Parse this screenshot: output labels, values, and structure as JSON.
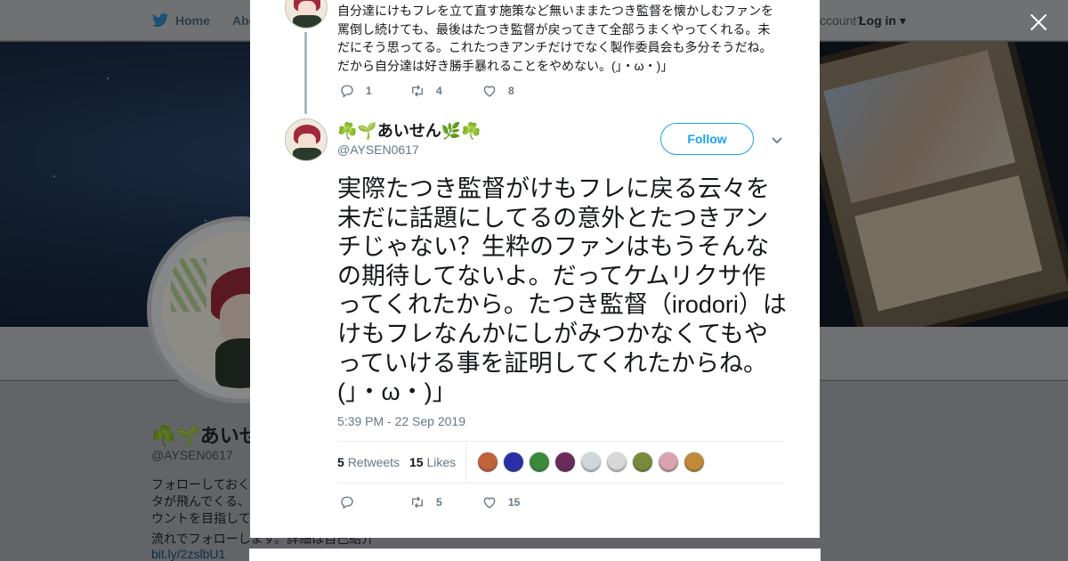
{
  "nav": {
    "home": "Home",
    "about": "Abo",
    "account_prompt": "ccount?",
    "login": "Log in"
  },
  "profile": {
    "name": "☘️🌱あいせ",
    "handle": "@AYSEN0617",
    "bio": "フォローしておく\nタが飛んでくる、\nウントを目指して",
    "bio_tail": "流れでフォローします。詳細は自己紹介",
    "link": "bit.ly/2zslbU1"
  },
  "previous_tweet": {
    "text": "自分達にけもフレを立て直す施策など無いままたつき監督を懐かしむファンを罵倒し続けても、最後はたつき監督が戻ってきて全部うまくやってくれる。未だにそう思ってる。これたつきアンチだけでなく製作委員会も多分そうだね。だから自分達は好き勝手暴れることをやめない。(」・ω・)」",
    "replies": "1",
    "retweets": "4",
    "likes": "8"
  },
  "tweet": {
    "display_name": "☘️🌱あいせん🌿☘️",
    "handle": "@AYSEN0617",
    "follow_label": "Follow",
    "text": "実際たつき監督がけもフレに戻る云々を未だに話題にしてるの意外とたつきアンチじゃない？生粋のファンはもうそんなの期待してないよ。だってケムリクサ作ってくれたから。たつき監督（irodori）はけもフレなんかにしがみつかなくてもやっていける事を証明してくれたからね。(」・ω・)」",
    "timestamp": "5:39 PM - 22 Sep 2019",
    "retweet_count": "5",
    "retweet_label": "Retweets",
    "like_count": "15",
    "like_label": "Likes",
    "action_retweets": "5",
    "action_likes": "15",
    "liker_avatar_colors": [
      "#c0623a",
      "#2a2fa8",
      "#3a8a3a",
      "#6a2a5a",
      "#cfd6dc",
      "#d8d8d8",
      "#7a8a3a",
      "#d9a3b0",
      "#c08a3a"
    ]
  },
  "colors": {
    "accent": "#1da1f2",
    "muted": "#657786"
  }
}
